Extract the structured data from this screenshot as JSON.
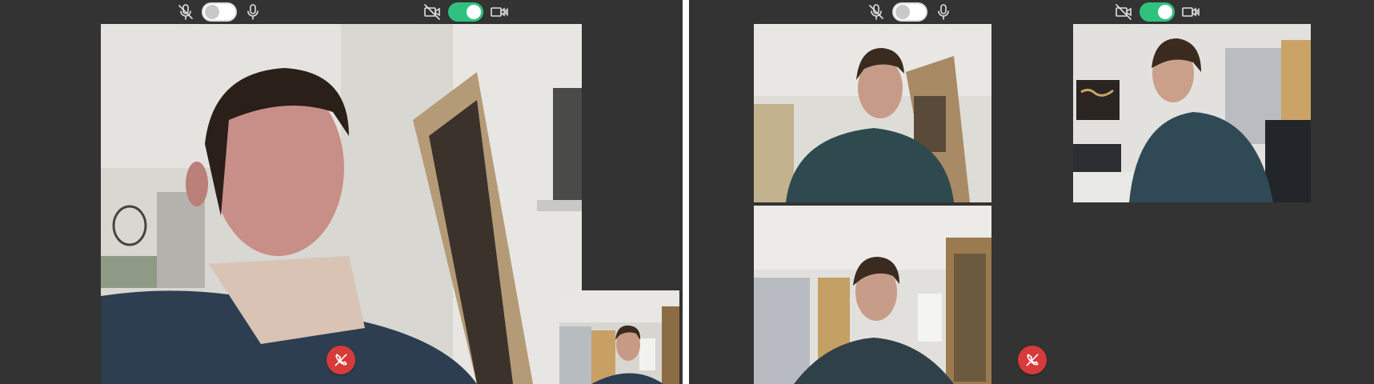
{
  "panels": [
    {
      "controls": {
        "audio": {
          "muted_icon": "mic-off-icon",
          "toggle_state": "off",
          "unmuted_icon": "mic-icon"
        },
        "video": {
          "off_icon": "video-off-icon",
          "toggle_state": "on",
          "on_icon": "video-speaker-icon"
        }
      },
      "tiles": [
        {
          "role": "main-participant-video"
        },
        {
          "role": "self-view-video"
        }
      ],
      "hangup": {
        "icon": "phone-hangup-icon",
        "color": "#d63a3a"
      }
    },
    {
      "controls": {
        "audio": {
          "muted_icon": "mic-off-icon",
          "toggle_state": "off",
          "unmuted_icon": "mic-icon"
        },
        "video": {
          "off_icon": "video-off-icon",
          "toggle_state": "on",
          "on_icon": "video-speaker-icon"
        }
      },
      "tiles": [
        {
          "role": "participant-video-1"
        },
        {
          "role": "participant-video-2"
        },
        {
          "role": "participant-video-3"
        }
      ],
      "hangup": {
        "icon": "phone-hangup-icon",
        "color": "#d63a3a"
      }
    }
  ],
  "colors": {
    "background": "#333333",
    "toggle_on": "#2ec27e",
    "toggle_off": "#ffffff",
    "divider": "#ffffff"
  }
}
